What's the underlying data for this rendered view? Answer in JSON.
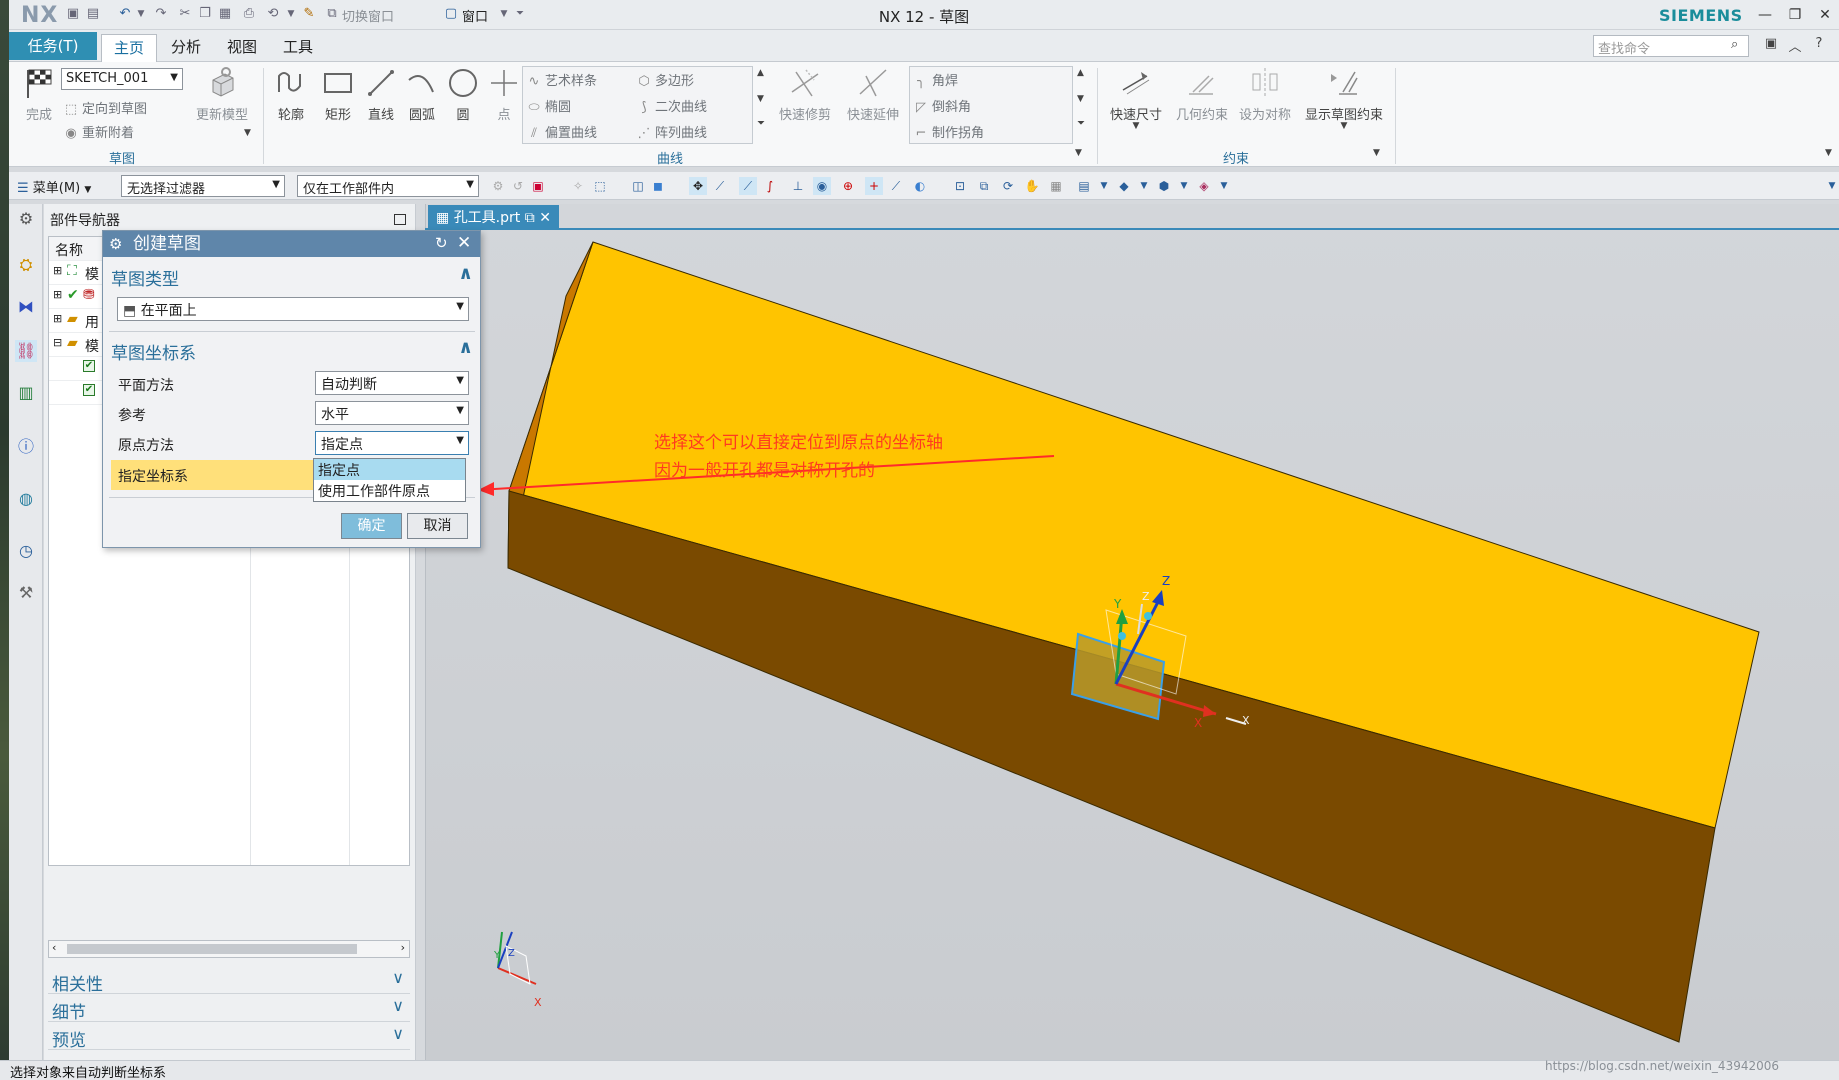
{
  "window": {
    "logo": "NX",
    "title": "NX 12 - 草图",
    "brand": "SIEMENS",
    "switch_window": "切换窗口",
    "window_menu": "窗口"
  },
  "menu_tabs": {
    "task": "任务(T)",
    "home": "主页",
    "analysis": "分析",
    "view": "视图",
    "tools": "工具",
    "search_placeholder": "查找命令"
  },
  "ribbon": {
    "finish": "完成",
    "sketch_name": "SKETCH_001",
    "orient_to_sketch": "定向到草图",
    "reattach": "重新附着",
    "update_model": "更新模型",
    "group_sketch": "草图",
    "profile": "轮廓",
    "rectangle": "矩形",
    "line": "直线",
    "arc": "圆弧",
    "circle": "圆",
    "point": "点",
    "studio_spline": "艺术样条",
    "polygon": "多边形",
    "ellipse": "椭圆",
    "conic": "二次曲线",
    "offset_curve": "偏置曲线",
    "pattern_curve": "阵列曲线",
    "quick_trim": "快速修剪",
    "quick_extend": "快速延伸",
    "fillet": "角焊",
    "chamfer": "倒斜角",
    "make_corner": "制作拐角",
    "group_curve": "曲线",
    "rapid_dimension": "快速尺寸",
    "geometric_constraints": "几何约束",
    "make_symmetric": "设为对称",
    "display_sketch_constraints": "显示草图约束",
    "group_constraints": "约束"
  },
  "toolbar": {
    "menu": "菜单(M)",
    "filter": "无选择过滤器",
    "scope": "仅在工作部件内"
  },
  "navigator": {
    "title": "部件导航器",
    "col_name": "名称",
    "rows": [
      "模",
      "",
      "用",
      "模"
    ],
    "panel_dependencies": "相关性",
    "panel_details": "细节",
    "panel_preview": "预览"
  },
  "graphics": {
    "file_tab": "孔工具.prt",
    "axis_x": "X",
    "axis_y": "Y",
    "axis_z": "Z"
  },
  "dialog": {
    "title": "创建草图",
    "section_type": "草图类型",
    "type_value": "在平面上",
    "section_csys": "草图坐标系",
    "plane_method_label": "平面方法",
    "plane_method_value": "自动判断",
    "reference_label": "参考",
    "reference_value": "水平",
    "origin_method_label": "原点方法",
    "origin_method_value": "指定点",
    "specify_csys_label": "指定坐标系",
    "dropdown_options": [
      "指定点",
      "使用工作部件原点"
    ],
    "ok": "确定",
    "cancel": "取消"
  },
  "annotation": {
    "line1": "选择这个可以直接定位到原点的坐标轴",
    "line2": "因为一般开孔都是对称开孔的",
    "color": "#ff3b1f"
  },
  "status": {
    "message": "选择对象来自动判断坐标系",
    "watermark": "https://blog.csdn.net/weixin_43942006"
  },
  "colors": {
    "accent": "#2f8fb3",
    "block_top": "#ffc400",
    "block_side": "#7a4a00",
    "block_end": "#c97800"
  }
}
